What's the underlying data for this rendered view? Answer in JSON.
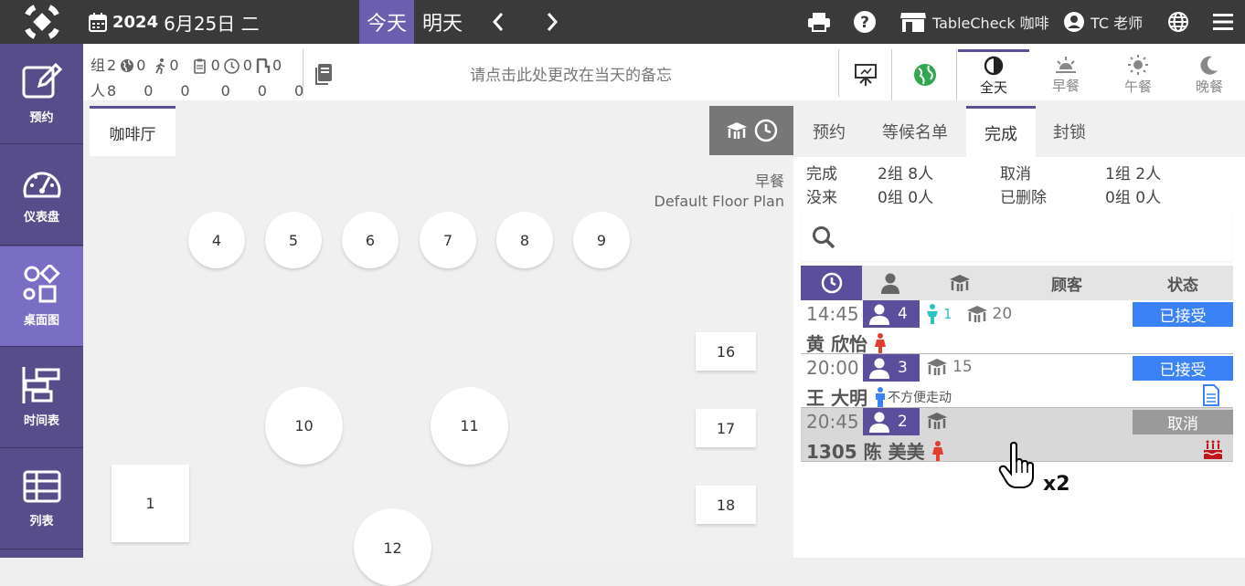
{
  "header": {
    "year": "2024",
    "date": "6月25日 二",
    "today_label": "今天",
    "tomorrow_label": "明天",
    "venue": "TableCheck 咖啡",
    "user": "TC 老师"
  },
  "sidebar": {
    "items": [
      {
        "label": "预约",
        "icon": "edit-icon"
      },
      {
        "label": "仪表盘",
        "icon": "dashboard-icon"
      },
      {
        "label": "桌面图",
        "icon": "floor-map-icon"
      },
      {
        "label": "时间表",
        "icon": "timetable-icon"
      },
      {
        "label": "列表",
        "icon": "list-icon"
      }
    ]
  },
  "stats": {
    "group_label": "组",
    "people_label": "人",
    "groups": [
      "2",
      "0",
      "0",
      "0",
      "0",
      "0"
    ],
    "people": [
      "8",
      "0",
      "0",
      "0",
      "0",
      "0"
    ]
  },
  "memo": {
    "placeholder": "请点击此处更改在当天的备忘"
  },
  "meals": [
    {
      "label": "全天"
    },
    {
      "label": "早餐"
    },
    {
      "label": "午餐"
    },
    {
      "label": "晚餐"
    }
  ],
  "floor": {
    "room_tab": "咖啡厅",
    "meal_label": "早餐",
    "plan_name": "Default Floor Plan",
    "tables": [
      "4",
      "5",
      "6",
      "7",
      "8",
      "9",
      "16",
      "10",
      "11",
      "17",
      "1",
      "18",
      "12"
    ]
  },
  "right": {
    "tabs": [
      "预约",
      "等候名单",
      "完成",
      "封锁"
    ],
    "summary": {
      "done_label": "完成",
      "done_groups": "2",
      "done_people": "8",
      "noshow_label": "没来",
      "noshow_groups": "0",
      "noshow_people": "0",
      "cancel_label": "取消",
      "cancel_groups": "1",
      "cancel_people": "2",
      "deleted_label": "已删除",
      "deleted_groups": "0",
      "deleted_people": "0",
      "group_unit": "组",
      "people_unit": "人"
    },
    "columns": {
      "guest": "顾客",
      "status": "状态"
    },
    "reservations": [
      {
        "time": "14:45",
        "people": "4",
        "kids": "1",
        "table": "20",
        "name": "黄 欣怡",
        "status": "已接受",
        "note": ""
      },
      {
        "time": "20:00",
        "people": "3",
        "kids": "",
        "table": "15",
        "name": "王 大明",
        "status": "已接受",
        "note": "不方便走动"
      },
      {
        "time": "20:45",
        "people": "2",
        "kids": "",
        "table": "",
        "name": "1305 陈 美美",
        "status": "取消",
        "note": ""
      }
    ]
  },
  "overlay": {
    "click_count": "x2"
  },
  "colors": {
    "accent": "#5b4e9c",
    "accepted": "#3b82f6",
    "cancelled": "#9a9a9a",
    "topbar": "#3a3a3a"
  }
}
